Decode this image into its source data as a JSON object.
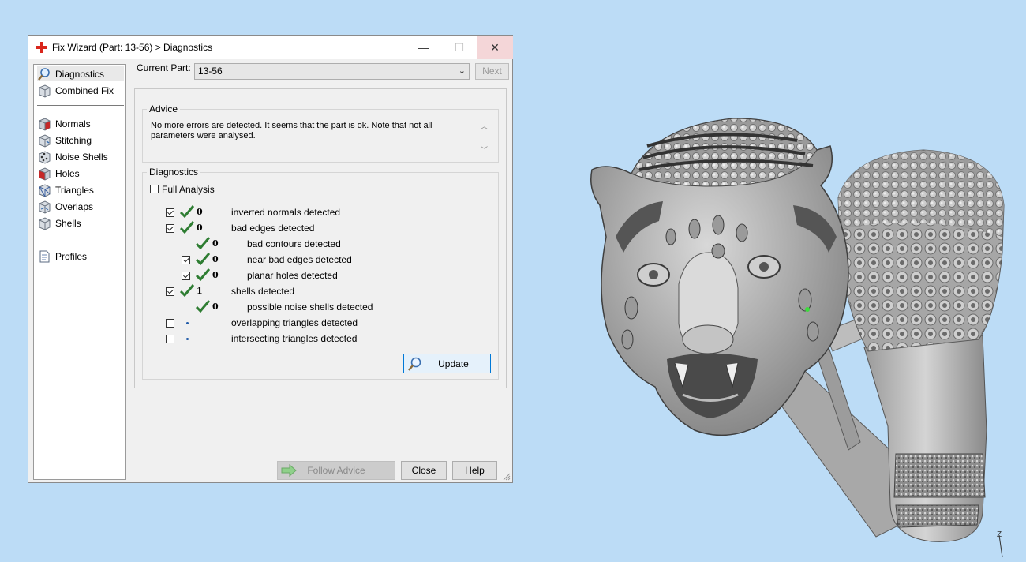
{
  "window": {
    "title": "Fix Wizard (Part: 13-56) > Diagnostics",
    "controls": {
      "minimize": "—",
      "maximize": "☐",
      "close": "✕"
    }
  },
  "sidebar": {
    "items": [
      {
        "label": "Diagnostics",
        "icon": "magnifier-icon",
        "selected": true
      },
      {
        "label": "Combined Fix",
        "icon": "cube-icon"
      },
      {
        "label": "Normals",
        "icon": "normals-cube-icon"
      },
      {
        "label": "Stitching",
        "icon": "stitching-cube-icon"
      },
      {
        "label": "Noise Shells",
        "icon": "noise-shells-icon"
      },
      {
        "label": "Holes",
        "icon": "holes-cube-icon"
      },
      {
        "label": "Triangles",
        "icon": "triangles-cube-icon"
      },
      {
        "label": "Overlaps",
        "icon": "overlaps-cube-icon"
      },
      {
        "label": "Shells",
        "icon": "shells-cube-icon"
      },
      {
        "label": "Profiles",
        "icon": "document-icon"
      }
    ]
  },
  "header": {
    "current_part_label": "Current Part:",
    "current_part_value": "13-56",
    "next_label": "Next"
  },
  "advice": {
    "legend": "Advice",
    "text": "No more errors are detected. It seems that the part is ok. Note that not all parameters were analysed."
  },
  "diagnostics": {
    "legend": "Diagnostics",
    "full_analysis_label": "Full Analysis",
    "full_analysis_checked": false,
    "rows": [
      {
        "checkbox": true,
        "status": "ok",
        "count": "0",
        "label": "inverted normals detected"
      },
      {
        "checkbox": true,
        "status": "ok",
        "count": "0",
        "label": "bad edges detected"
      },
      {
        "checkbox": null,
        "status": "ok",
        "count": "0",
        "label": "bad contours detected"
      },
      {
        "checkbox": true,
        "status": "ok",
        "count": "0",
        "label": "near bad edges detected"
      },
      {
        "checkbox": true,
        "status": "ok",
        "count": "0",
        "label": "planar holes detected"
      },
      {
        "checkbox": true,
        "status": "ok",
        "count": "1",
        "label": "shells detected"
      },
      {
        "checkbox": null,
        "status": "ok",
        "count": "0",
        "label": "possible noise shells detected"
      },
      {
        "checkbox": false,
        "status": "pending",
        "count": "",
        "label": "overlapping triangles detected"
      },
      {
        "checkbox": false,
        "status": "pending",
        "count": "",
        "label": "intersecting triangles detected"
      }
    ],
    "update_label": "Update"
  },
  "footer": {
    "follow_advice_label": "Follow Advice",
    "close_label": "Close",
    "help_label": "Help"
  },
  "viewport": {
    "axis_label": "Z",
    "background": "#bcdcf6"
  },
  "colors": {
    "tick": "#2e7d32",
    "accent": "#0078d7",
    "close_hover": "#f4d6d8"
  }
}
